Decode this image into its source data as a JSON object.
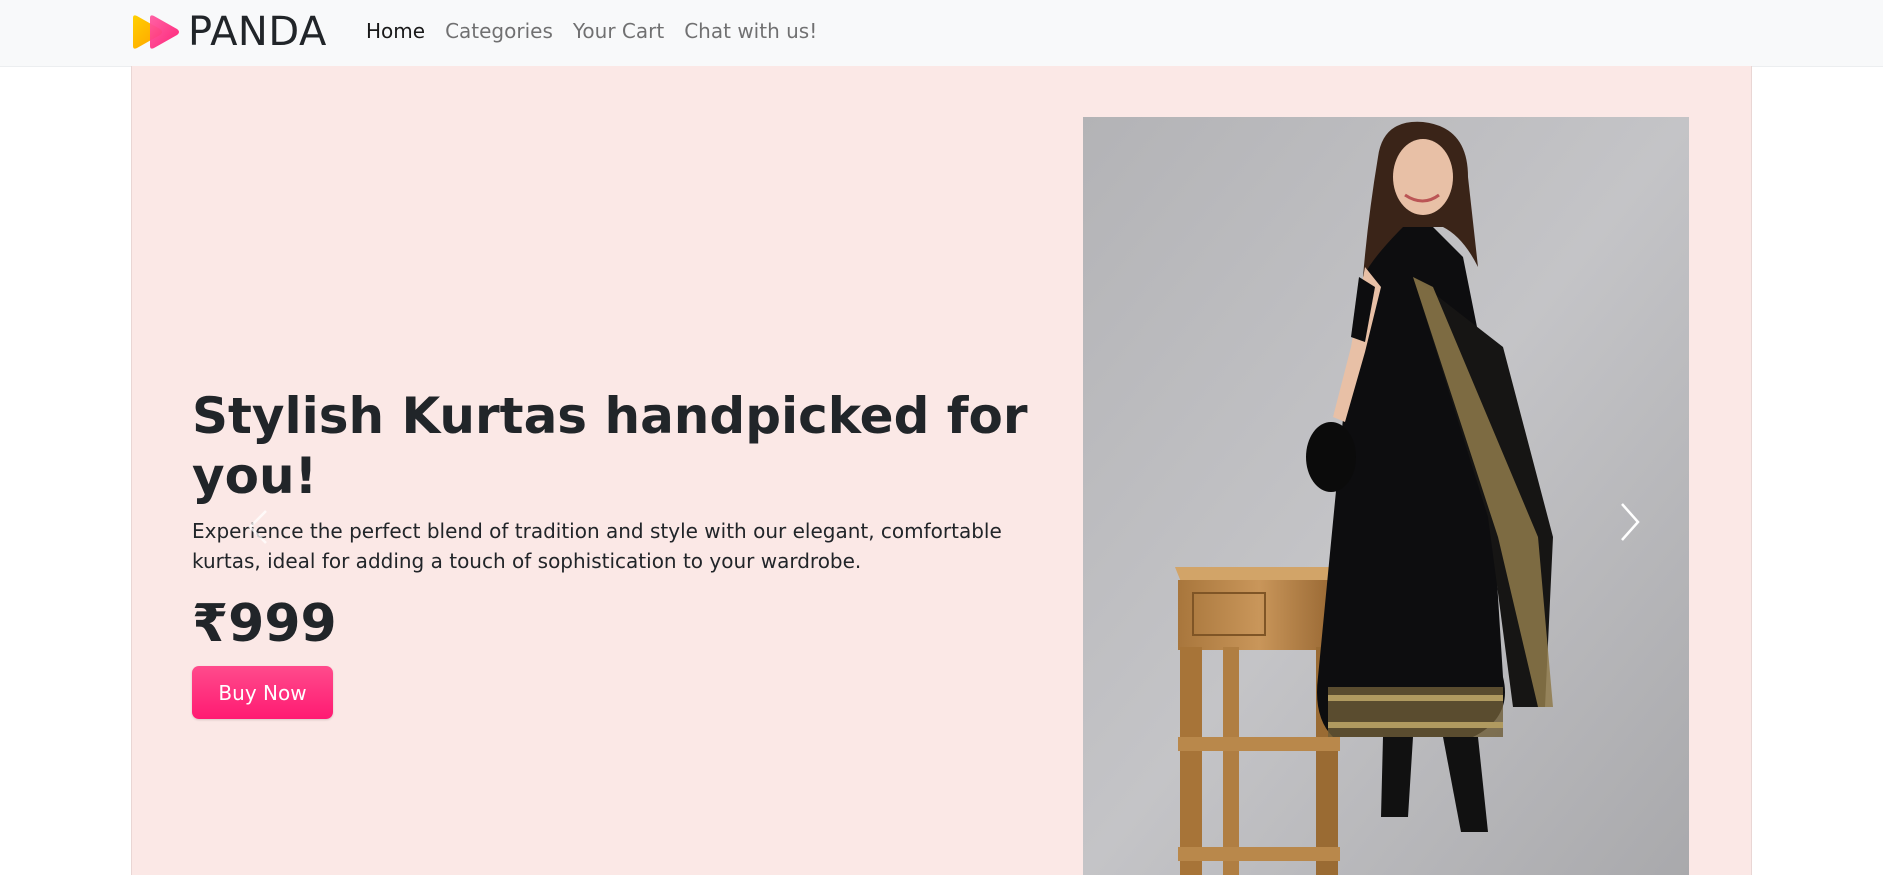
{
  "nav": {
    "brand_name": "PANDA",
    "links": [
      "Home",
      "Categories",
      "Your Cart",
      "Chat with us!"
    ],
    "active_link": "Home"
  },
  "hero": {
    "title": "Stylish Kurtas handpicked for you!",
    "description": "Experience the perfect blend of tradition and style with our elegant, comfortable kurtas, ideal for adding a touch of sophistication to your wardrobe.",
    "price": "₹999",
    "button_label": "Buy Now"
  },
  "colors": {
    "accent": "#ff1a72",
    "hero_bg": "#fbe8e6",
    "navbar_bg": "#f8f9fa",
    "logo_yellow": "#ffb400",
    "logo_pink": "#ff2d7a"
  },
  "icons": {
    "logo": "play-arrows-logo-icon",
    "carousel_prev": "chevron-left-icon",
    "carousel_next": "chevron-right-icon"
  }
}
